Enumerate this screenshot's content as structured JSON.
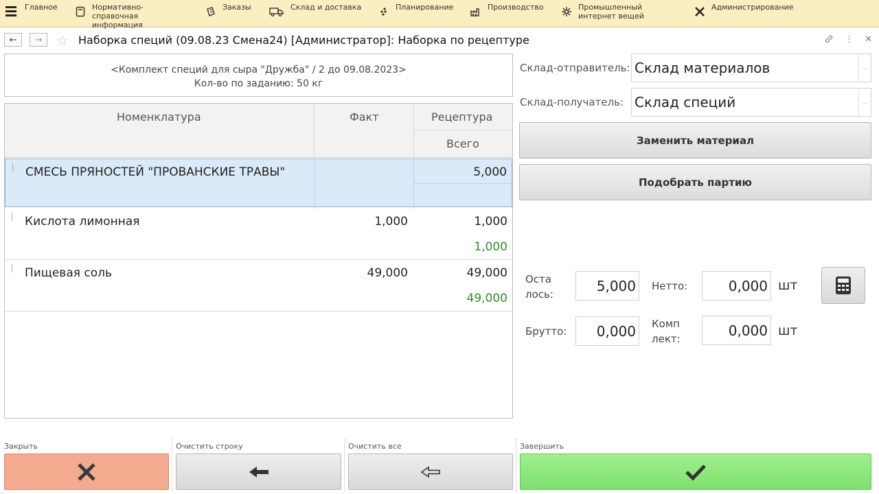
{
  "menu": {
    "items": [
      {
        "label": "Главное",
        "icon": "hamburger-icon"
      },
      {
        "label": "Нормативно-справочная информация",
        "icon": "book-icon"
      },
      {
        "label": "Заказы",
        "icon": "orders-icon"
      },
      {
        "label": "Склад и доставка",
        "icon": "truck-icon"
      },
      {
        "label": "Планирование",
        "icon": "planning-icon"
      },
      {
        "label": "Производство",
        "icon": "factory-icon"
      },
      {
        "label": "Промышленный интернет вещей",
        "icon": "iot-icon"
      },
      {
        "label": "Администрирование",
        "icon": "tools-icon"
      }
    ]
  },
  "window": {
    "title": "Наборка специй (09.08.23 Смена24) [Администратор]: Наборка по рецептуре"
  },
  "task": {
    "line1": "<Комплект специй для сыра \"Дружба\" / 2 до 09.08.2023>",
    "line2": "Кол-во по заданию: 50 кг"
  },
  "table": {
    "headers": {
      "name": "Номенклатура",
      "fact": "Факт",
      "recipe": "Рецептура",
      "total": "Всего"
    },
    "rows": [
      {
        "name": "СМЕСЬ ПРЯНОСТЕЙ \"ПРОВАНСКИЕ ТРАВЫ\"",
        "fact": "",
        "recipe": "5,000",
        "total": "",
        "selected": true
      },
      {
        "name": "Кислота лимонная",
        "fact": "1,000",
        "recipe": "1,000",
        "total": "1,000",
        "selected": false
      },
      {
        "name": "Пищевая соль",
        "fact": "49,000",
        "recipe": "49,000",
        "total": "49,000",
        "selected": false
      }
    ]
  },
  "right": {
    "sender_label": "Склад-отправитель:",
    "sender_value": "Склад материалов",
    "receiver_label": "Склад-получатель:",
    "receiver_value": "Склад специй",
    "replace_button": "Заменить материал",
    "batch_button": "Подобрать партию",
    "remaining_label_1": "Оста",
    "remaining_label_2": "лось:",
    "remaining_value": "5,000",
    "netto_label": "Нетто:",
    "netto_value": "0,000",
    "netto_unit": "шт",
    "brutto_label": "Брутто:",
    "brutto_value": "0,000",
    "kit_label_1": "Комп",
    "kit_label_2": "лект:",
    "kit_value": "0,000",
    "kit_unit": "шт"
  },
  "bottom": {
    "close_label": "Закрыть",
    "clear_row_label": "Очистить строку",
    "clear_all_label": "Очистить все",
    "finish_label": "Завершить"
  },
  "colors": {
    "menu_bg": "#fbeec0",
    "selected_row": "#dbeaf8",
    "total_green": "#2e8b2e",
    "close_btn": "#f4aa8e",
    "finish_btn": "#8ee87d"
  }
}
